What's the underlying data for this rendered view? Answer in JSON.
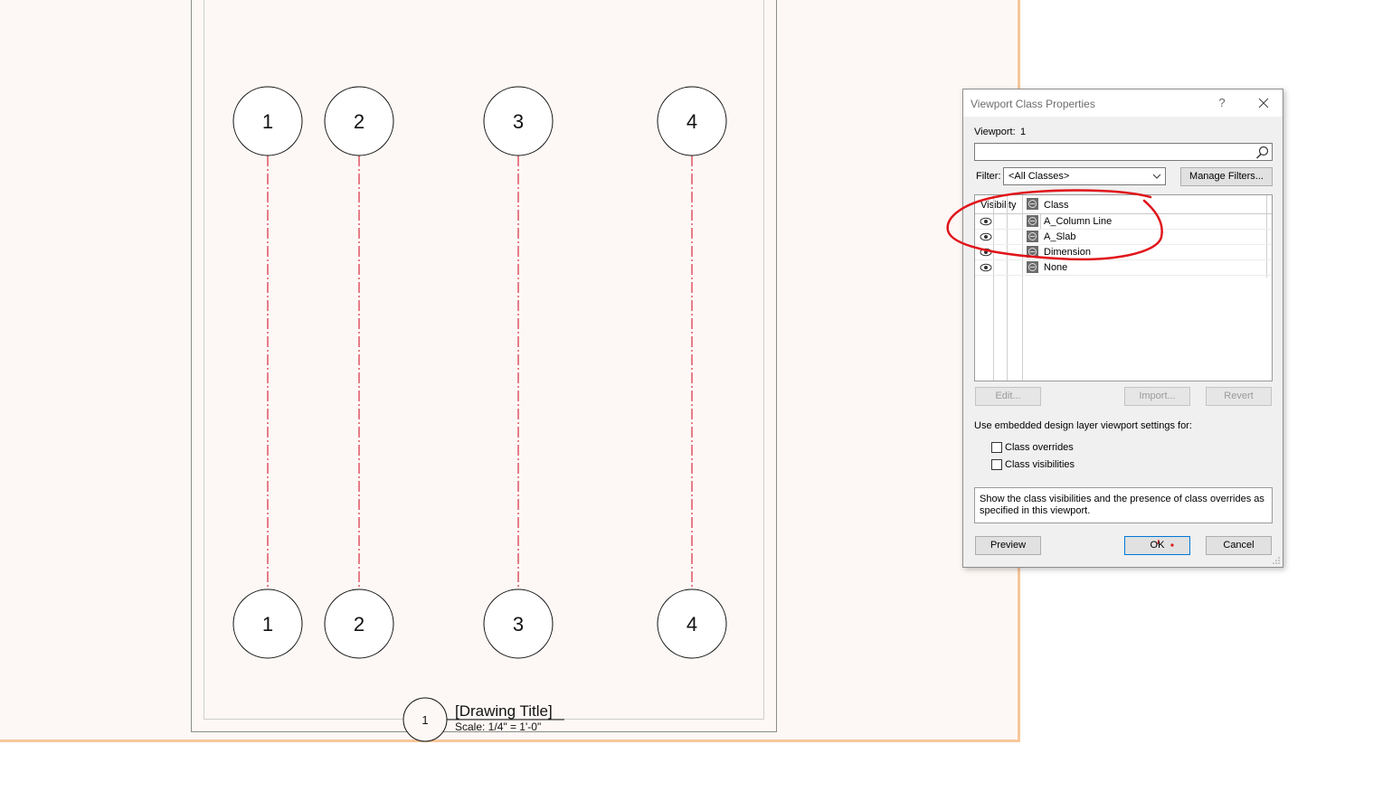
{
  "drawing": {
    "grid_labels": [
      "1",
      "2",
      "3",
      "4"
    ],
    "title_mark_number": "1",
    "drawing_title": "[Drawing Title]",
    "scale": "Scale: 1/4\" = 1'-0\""
  },
  "dialog": {
    "title": "Viewport Class Properties",
    "help_label": "?",
    "viewport_label": "Viewport:",
    "viewport_value": "1",
    "search_value": "",
    "filter_label": "Filter:",
    "filter_value": "<All Classes>",
    "manage_filters_label": "Manage Filters...",
    "columns": {
      "visibility": "Visibility",
      "class": "Class"
    },
    "rows": [
      {
        "name": "A_Column Line"
      },
      {
        "name": "A_Slab"
      },
      {
        "name": "Dimension"
      },
      {
        "name": "None"
      }
    ],
    "edit_label": "Edit...",
    "import_label": "Import...",
    "revert_label": "Revert",
    "embedded_label": "Use embedded design layer viewport settings for:",
    "class_overrides_label": "Class overrides",
    "class_visibilities_label": "Class visibilities",
    "description": "Show the class visibilities and the presence of class overrides as specified in this viewport.",
    "preview_label": "Preview",
    "ok_label": "OK",
    "cancel_label": "Cancel"
  },
  "colors": {
    "gridline": "#d0021b",
    "annotation": "#e0151b",
    "page_border": "#f8c79a"
  }
}
